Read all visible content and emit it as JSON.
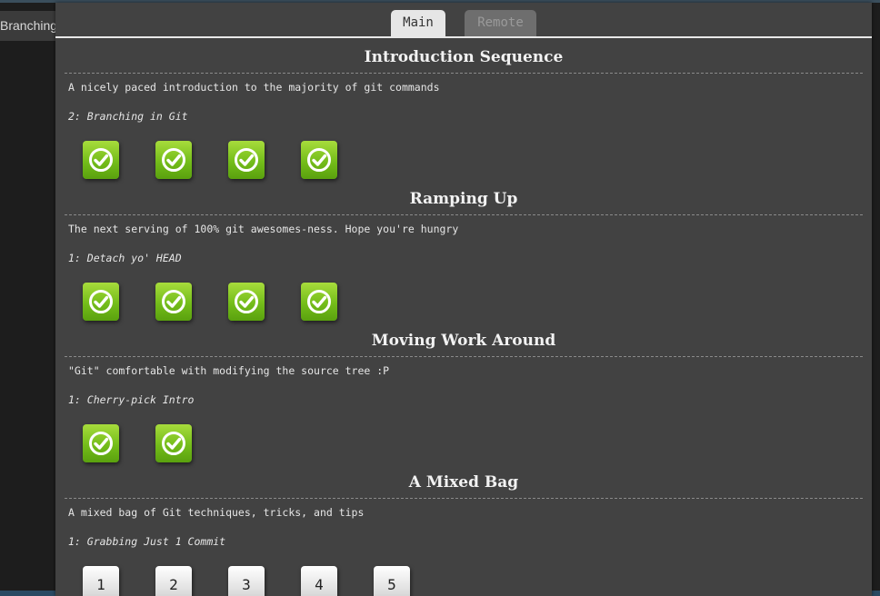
{
  "background_tab": {
    "label": "Branching"
  },
  "tabs": [
    {
      "label": "Main",
      "active": true
    },
    {
      "label": "Remote",
      "active": false
    }
  ],
  "sections": [
    {
      "title": "Introduction Sequence",
      "about": "A nicely paced introduction to the majority of git commands",
      "current_level": "2: Branching in Git",
      "levels": [
        {
          "status": "complete",
          "icon": "check-icon"
        },
        {
          "status": "complete",
          "icon": "check-icon"
        },
        {
          "status": "complete",
          "icon": "check-icon"
        },
        {
          "status": "complete",
          "icon": "check-icon"
        }
      ]
    },
    {
      "title": "Ramping Up",
      "about": "The next serving of 100% git awesomes-ness. Hope you're hungry",
      "current_level": "1: Detach yo' HEAD",
      "levels": [
        {
          "status": "complete",
          "icon": "check-icon"
        },
        {
          "status": "complete",
          "icon": "check-icon"
        },
        {
          "status": "complete",
          "icon": "check-icon"
        },
        {
          "status": "complete",
          "icon": "check-icon"
        }
      ]
    },
    {
      "title": "Moving Work Around",
      "about": "\"Git\" comfortable with modifying the source tree :P",
      "current_level": "1: Cherry-pick Intro",
      "levels": [
        {
          "status": "complete",
          "icon": "check-icon"
        },
        {
          "status": "complete",
          "icon": "check-icon"
        }
      ]
    },
    {
      "title": "A Mixed Bag",
      "about": "A mixed bag of Git techniques, tricks, and tips",
      "current_level": "1: Grabbing Just 1 Commit",
      "levels": [
        {
          "status": "incomplete",
          "number": "1"
        },
        {
          "status": "incomplete",
          "number": "2"
        },
        {
          "status": "incomplete",
          "number": "3"
        },
        {
          "status": "incomplete",
          "number": "4"
        },
        {
          "status": "incomplete",
          "number": "5"
        }
      ]
    }
  ],
  "colors": {
    "complete_green": "#74bd1a",
    "panel_bg": "#424242",
    "text": "#e6e6e6"
  }
}
